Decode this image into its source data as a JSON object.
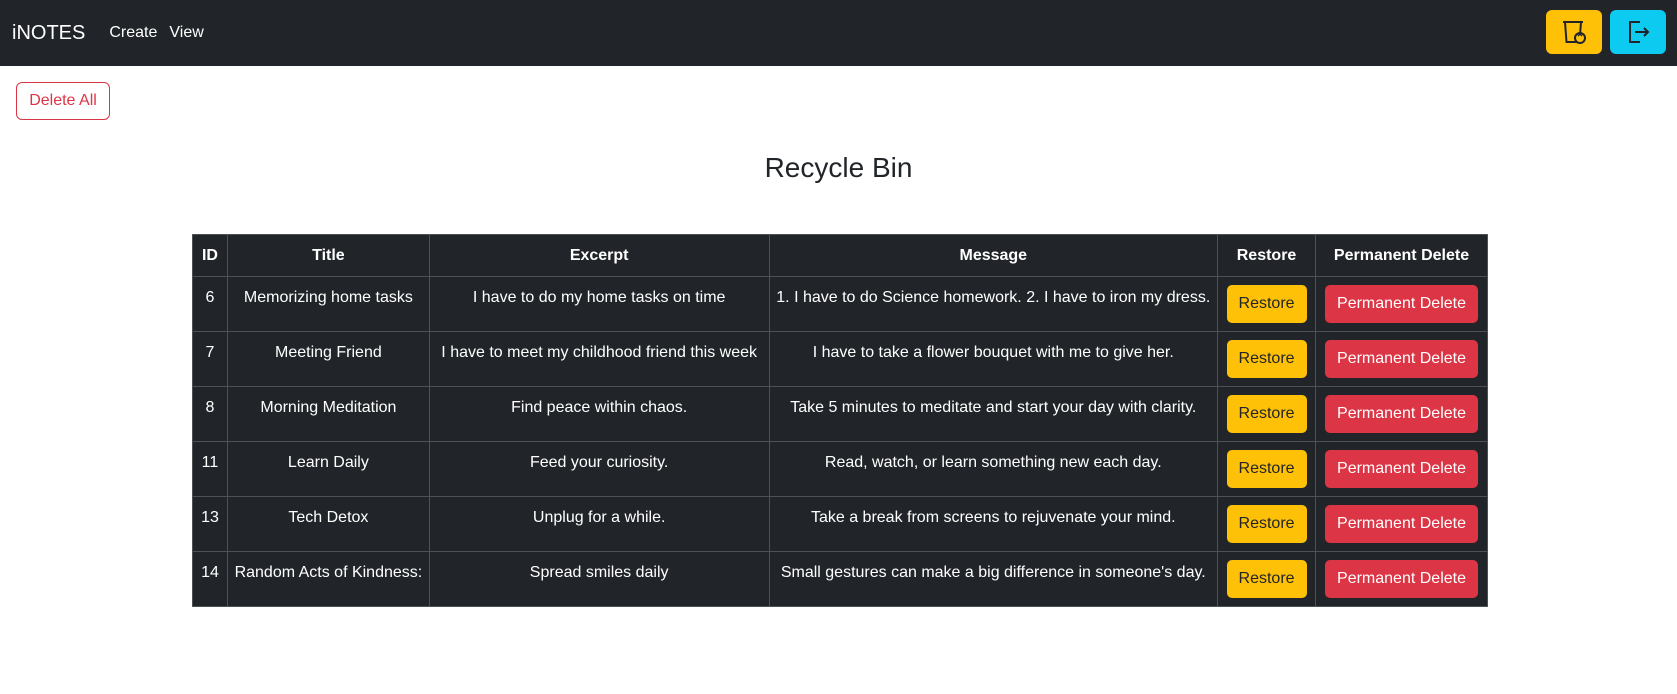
{
  "nav": {
    "brand": "iNOTES",
    "links": [
      "Create",
      "View"
    ],
    "recycle_icon": "recycle-bin-icon",
    "logout_icon": "logout-icon",
    "colors": {
      "recycle": "#ffc107",
      "logout": "#0dcaf0"
    }
  },
  "toolbar": {
    "delete_all_label": "Delete All"
  },
  "page": {
    "title": "Recycle Bin"
  },
  "table": {
    "headers": [
      "ID",
      "Title",
      "Excerpt",
      "Message",
      "Restore",
      "Permanent Delete"
    ],
    "rows": [
      {
        "id": "6",
        "title": "Memorizing home tasks",
        "excerpt": "I have to do my home tasks on time",
        "message": "1. I have to do Science homework. 2. I have to iron my dress.",
        "restore": "Restore",
        "delete": "Permanent Delete"
      },
      {
        "id": "7",
        "title": "Meeting Friend",
        "excerpt": "I have to meet my childhood friend this week",
        "message": "I have to take a flower bouquet with me to give her.",
        "restore": "Restore",
        "delete": "Permanent Delete"
      },
      {
        "id": "8",
        "title": "Morning Meditation",
        "excerpt": "Find peace within chaos.",
        "message": "Take 5 minutes to meditate and start your day with clarity.",
        "restore": "Restore",
        "delete": "Permanent Delete"
      },
      {
        "id": "11",
        "title": "Learn Daily",
        "excerpt": "Feed your curiosity.",
        "message": "Read, watch, or learn something new each day.",
        "restore": "Restore",
        "delete": "Permanent Delete"
      },
      {
        "id": "13",
        "title": "Tech Detox",
        "excerpt": "Unplug for a while.",
        "message": "Take a break from screens to rejuvenate your mind.",
        "restore": "Restore",
        "delete": "Permanent Delete"
      },
      {
        "id": "14",
        "title": "Random Acts of Kindness:",
        "excerpt": "Spread smiles daily",
        "message": "Small gestures can make a big difference in someone's day.",
        "restore": "Restore",
        "delete": "Permanent Delete"
      }
    ]
  }
}
